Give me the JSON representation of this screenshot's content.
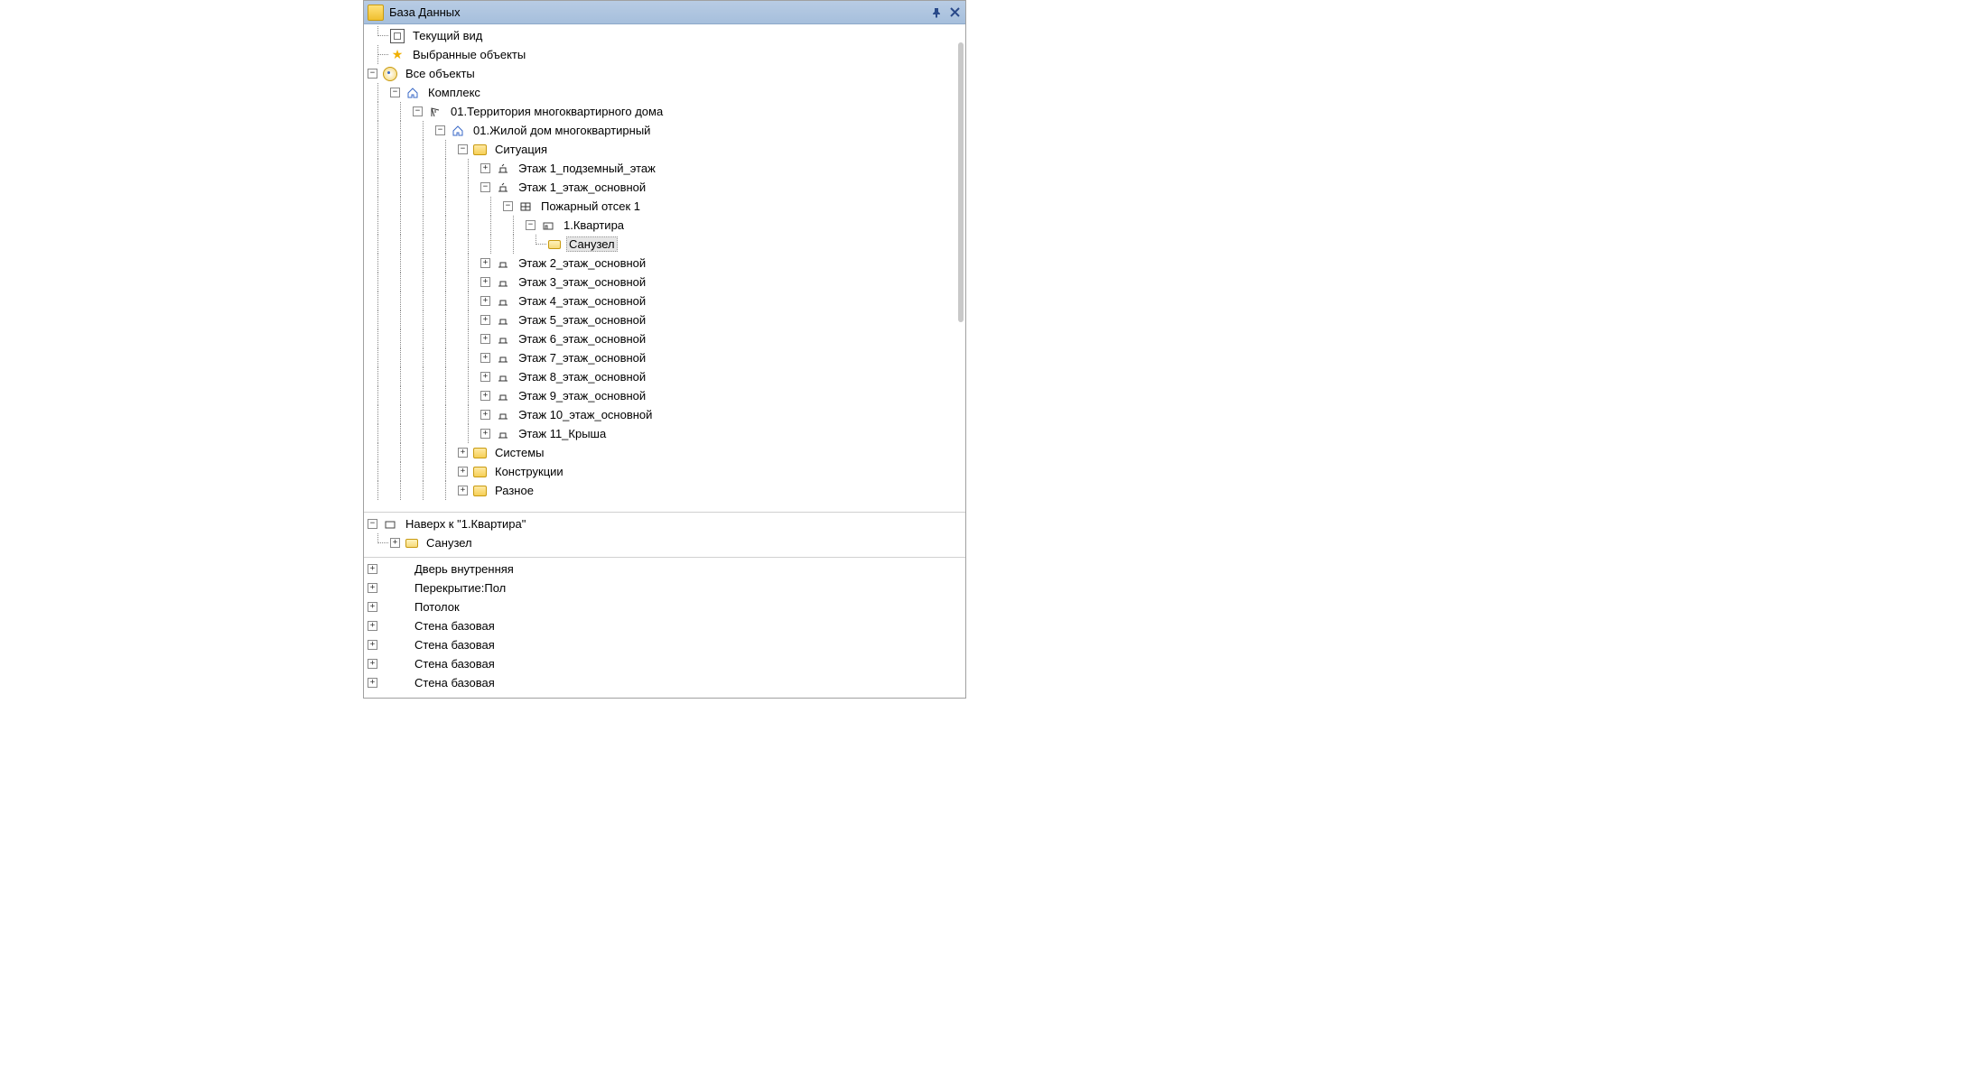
{
  "titlebar": {
    "title": "База Данных"
  },
  "tree": {
    "current_view": "Текущий вид",
    "selected_objects": "Выбранные объекты",
    "all_objects": "Все объекты",
    "complex": "Комплекс",
    "territory": "01.Территория многоквартирного дома",
    "building": "01.Жилой дом многоквартирный",
    "situation": "Ситуация",
    "floors": [
      "Этаж 1_подземный_этаж",
      "Этаж 1_этаж_основной",
      "Этаж 2_этаж_основной",
      "Этаж 3_этаж_основной",
      "Этаж 4_этаж_основной",
      "Этаж 5_этаж_основной",
      "Этаж 6_этаж_основной",
      "Этаж 7_этаж_основной",
      "Этаж 8_этаж_основной",
      "Этаж 9_этаж_основной",
      "Этаж 10_этаж_основной",
      "Этаж 11_Крыша"
    ],
    "fire_section": "Пожарный отсек 1",
    "apartment": "1.Квартира",
    "sanusel": "Санузел",
    "systems": "Системы",
    "constructions": "Конструкции",
    "misc": "Разное"
  },
  "secondary": {
    "up_to": "Наверх к \"1.Квартира\"",
    "sanusel": "Санузел"
  },
  "third": {
    "items": [
      "Дверь внутренняя",
      "Перекрытие:Пол",
      "Потолок",
      "Стена базовая",
      "Стена базовая",
      "Стена базовая",
      "Стена базовая"
    ]
  }
}
